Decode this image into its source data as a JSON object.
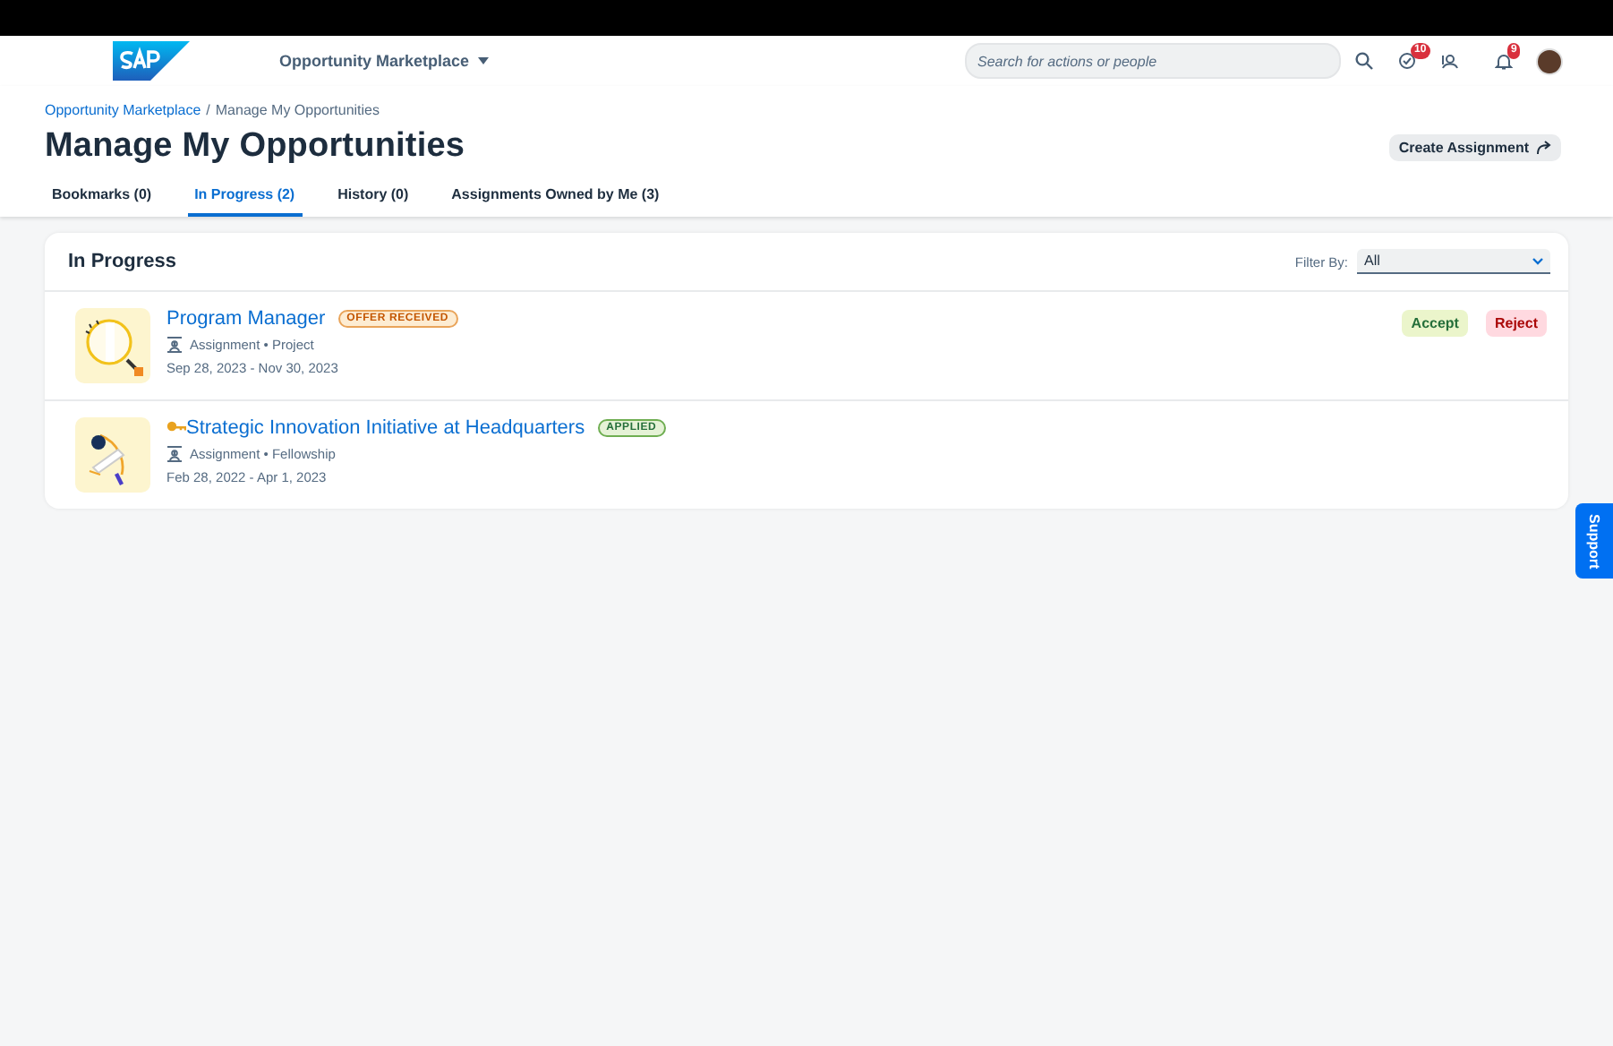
{
  "header": {
    "app_menu": "Opportunity Marketplace",
    "search": {
      "placeholder": "Search for actions or people"
    },
    "todo_badge": "10",
    "notification_badge": "9"
  },
  "breadcrumb": {
    "link": "Opportunity Marketplace",
    "separator": "/",
    "current": "Manage My Opportunities"
  },
  "page_title": "Manage My Opportunities",
  "create_button": "Create Assignment",
  "tabs": [
    {
      "label": "Bookmarks (0)",
      "selected": false
    },
    {
      "label": "In Progress (2)",
      "selected": true
    },
    {
      "label": "History (0)",
      "selected": false
    },
    {
      "label": "Assignments Owned by Me (3)",
      "selected": false
    }
  ],
  "section": {
    "title": "In Progress",
    "filter_label": "Filter By:",
    "filter_value": "All"
  },
  "items": [
    {
      "title": "Program Manager",
      "key_icon": false,
      "status": {
        "label": "OFFER RECEIVED",
        "kind": "offer"
      },
      "type": "Assignment • Project",
      "dates": "Sep 28, 2023 - Nov 30, 2023",
      "actions": [
        {
          "label": "Accept",
          "kind": "accept"
        },
        {
          "label": "Reject",
          "kind": "reject"
        }
      ]
    },
    {
      "title": "Strategic Innovation Initiative at Headquarters",
      "key_icon": true,
      "status": {
        "label": "APPLIED",
        "kind": "applied"
      },
      "type": "Assignment • Fellowship",
      "dates": "Feb 28, 2022 - Apr 1, 2023"
    }
  ],
  "support_tab": "Support"
}
